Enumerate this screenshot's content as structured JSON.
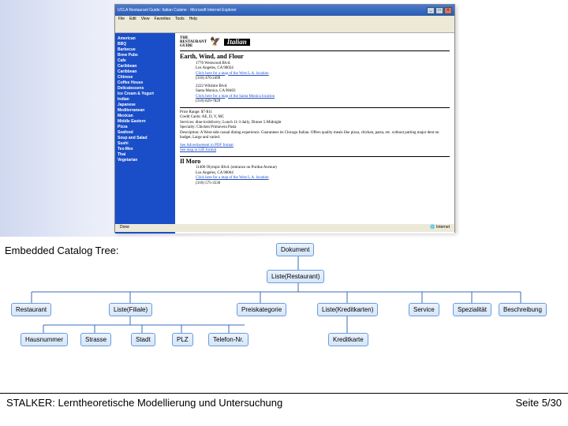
{
  "browser": {
    "title": "UCLA Restaurant Guide: Italian Cuisine - Microsoft Internet Explorer",
    "menu": [
      "File",
      "Edit",
      "View",
      "Favorites",
      "Tools",
      "Help"
    ],
    "logo_guide_line1": "THE",
    "logo_guide_line2": "RESTAURANT",
    "logo_guide_line3": "GUIDE",
    "logo_italian": "Italian",
    "status_left": "Done",
    "status_right": "Internet"
  },
  "sidebar": {
    "items": [
      "American",
      "BBQ",
      "Barbecue",
      "Brew Pubs",
      "Cafe",
      "Caribbean",
      "Caribbean",
      "Chinese",
      "Coffee House",
      "Delicatessens",
      "Ice Cream & Yogurt",
      "Indian",
      "Japanese",
      "Mediterranean",
      "Mexican",
      "Middle Eastern",
      "Pizza",
      "Seafood",
      "Soup and Salad",
      "Sushi",
      "Tex-Mex",
      "Thai",
      "Vegetarian"
    ]
  },
  "content": {
    "rest1_title": "Earth, Wind, and Flour",
    "rest1_addr1": "1776 Westwood Blvd.",
    "rest1_addr2": "Los Angeles, CA 90024",
    "rest1_map": "Click here for a map of the West L.A. location",
    "rest1_phone": "(310) 470-2499",
    "rest1b_addr1": "2222 Wilshire Blvd.",
    "rest1b_addr2": "Santa Monica, CA 90403",
    "rest1b_map": "Click here for a map of the Santa Monica location",
    "rest1b_phone": "(310) 829-7829",
    "price_range": "Price Range: $7-$11",
    "credit_cards": "Credit Cards: AE, D, V, MC",
    "services": "Services: dine-in/delivery; Lunch 11-3 daily, Dinner 5-Midnight",
    "specialty": "Specialty: Chicken Primavera Pasta",
    "description": "Description: A West-side casual dining experience. Guarantees its Chicago Italian. Offers quality meals like pizza, chicken, pasta, etc. without putting major dent on budget. Large and varied.",
    "ad_text": "See Advertisement in PDF format",
    "map_text": "See map in GIF format",
    "rest2_title": "Il Moro",
    "rest2_addr1": "11400 Olympic Blvd. (entrance on Purdue Avenue)",
    "rest2_addr2": "Los Angeles, CA 90064",
    "rest2_map": "Click here for a map of the West L.A. location",
    "rest2_phone": "(310) 575-3530"
  },
  "tree_label": "Embedded Catalog Tree:",
  "tree": {
    "root": "Dokument",
    "l1": "Liste(Restaurant)",
    "l2_0": "Restaurant",
    "l2_1": "Liste(Filiale)",
    "l2_2": "Preiskategorie",
    "l2_3": "Liste(Kreditkarten)",
    "l2_4": "Service",
    "l2_5": "Spezialität",
    "l2_6": "Beschreibung",
    "l3_0": "Hausnummer",
    "l3_1": "Strasse",
    "l3_2": "Stadt",
    "l3_3": "PLZ",
    "l3_4": "Telefon-Nr.",
    "l3_5": "Kreditkarte"
  },
  "footer": {
    "left": "STALKER: Lerntheoretische Modellierung und Untersuchung",
    "right": "Seite 5/30"
  }
}
